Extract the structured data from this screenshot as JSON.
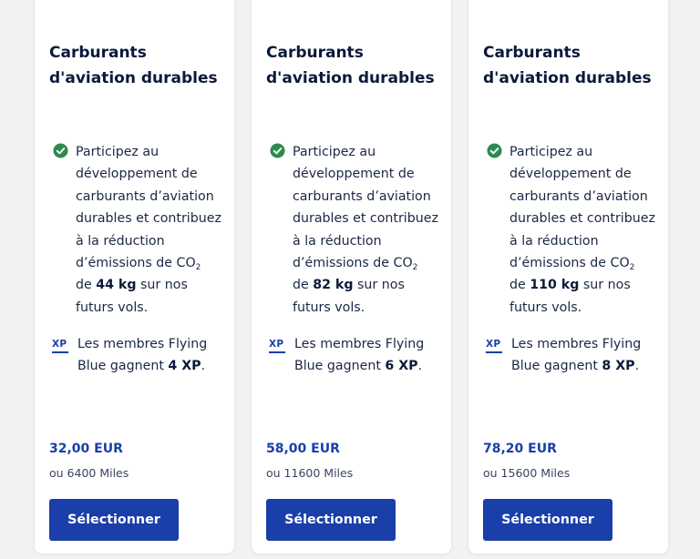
{
  "colors": {
    "accent": "#1a3eaa",
    "check": "#2e8a4f",
    "text": "#0b1a3a"
  },
  "icons": {
    "benefit": "check-circle-icon",
    "xp": "xp-icon"
  },
  "cards": [
    {
      "title_line1": "Carburants",
      "title_line2": "d'aviation durables",
      "benefit_lines": [
        "Participez au",
        "développement de",
        "carburants d’aviation",
        "durables et contribuez",
        "à la réduction"
      ],
      "co2_prefix": "d’émissions de CO",
      "co2_sub": "2",
      "amount_prefix": "de ",
      "amount": "44 kg",
      "amount_suffix": " sur nos",
      "benefit_end": "futurs vols.",
      "xp_icon_label": "XP",
      "xp_line1": "Les membres Flying",
      "xp_line2_prefix": "Blue gagnent ",
      "xp_value": "4 XP",
      "xp_line2_suffix": ".",
      "price": "32,00 EUR",
      "miles": "ou 6400 Miles",
      "button_label": "Sélectionner"
    },
    {
      "title_line1": "Carburants",
      "title_line2": "d'aviation durables",
      "benefit_lines": [
        "Participez au",
        "développement de",
        "carburants d’aviation",
        "durables et contribuez",
        "à la réduction"
      ],
      "co2_prefix": "d’émissions de CO",
      "co2_sub": "2",
      "amount_prefix": "de ",
      "amount": "82 kg",
      "amount_suffix": " sur nos",
      "benefit_end": "futurs vols.",
      "xp_icon_label": "XP",
      "xp_line1": "Les membres Flying",
      "xp_line2_prefix": "Blue gagnent ",
      "xp_value": "6 XP",
      "xp_line2_suffix": ".",
      "price": "58,00 EUR",
      "miles": "ou 11600 Miles",
      "button_label": "Sélectionner"
    },
    {
      "title_line1": "Carburants",
      "title_line2": "d'aviation durables",
      "benefit_lines": [
        "Participez au",
        "développement de",
        "carburants d’aviation",
        "durables et contribuez",
        "à la réduction"
      ],
      "co2_prefix": "d’émissions de CO",
      "co2_sub": "2",
      "amount_prefix": "de ",
      "amount": "110 kg",
      "amount_suffix": " sur nos",
      "benefit_end": "futurs vols.",
      "xp_icon_label": "XP",
      "xp_line1": "Les membres Flying",
      "xp_line2_prefix": "Blue gagnent ",
      "xp_value": "8 XP",
      "xp_line2_suffix": ".",
      "price": "78,20 EUR",
      "miles": "ou 15600 Miles",
      "button_label": "Sélectionner"
    }
  ]
}
